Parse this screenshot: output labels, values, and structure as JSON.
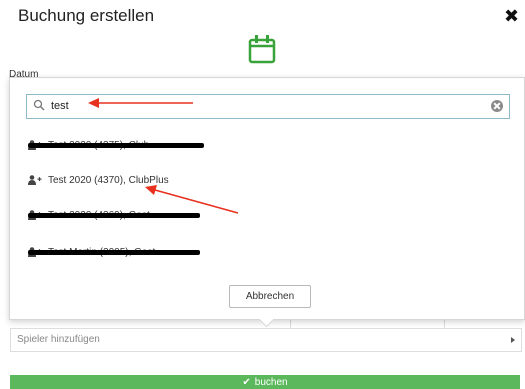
{
  "dialog": {
    "title": "Buchung erstellen",
    "date_label": "Datum",
    "accent_color": "#3aa23a"
  },
  "search": {
    "value": "test",
    "placeholder": ""
  },
  "results": [
    {
      "text": "Test 2020 (4375), Club",
      "redacted": true,
      "icon": "user-plus-icon"
    },
    {
      "text": "Test 2020 (4370), ClubPlus",
      "redacted": false,
      "icon": "user-plus-icon"
    },
    {
      "text": "Test 2020 (4369), Gast",
      "redacted": true,
      "icon": "user-plus-icon"
    },
    {
      "text": "Test Martin (2005), Gast",
      "redacted": true,
      "icon": "user-plus-icon"
    }
  ],
  "popup": {
    "cancel_label": "Abbrechen"
  },
  "player_field": {
    "placeholder": "Spieler hinzufügen"
  },
  "submit": {
    "label": "buchen",
    "color": "#5cb85c"
  },
  "annotation_color": "#e8301e"
}
